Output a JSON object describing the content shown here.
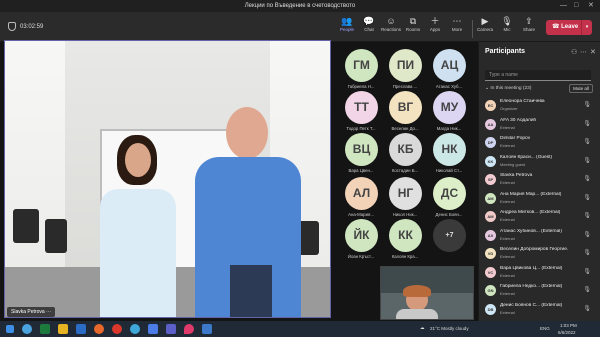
{
  "window": {
    "title": "Лекции по Въведение в счетоводството",
    "controls": [
      "—",
      "□",
      "✕"
    ]
  },
  "toolbar": {
    "timer": "03:02:59",
    "items": [
      {
        "label": "People",
        "icon": "people-icon",
        "glyph": "👥"
      },
      {
        "label": "Chat",
        "icon": "chat-icon",
        "glyph": "💬"
      },
      {
        "label": "Reactions",
        "icon": "reactions-icon",
        "glyph": "☺"
      },
      {
        "label": "Rooms",
        "icon": "rooms-icon",
        "glyph": "⧉"
      },
      {
        "label": "Apps",
        "icon": "apps-icon",
        "glyph": "＋"
      },
      {
        "label": "More",
        "icon": "more-icon",
        "glyph": "⋯"
      },
      {
        "label": "Camera",
        "icon": "camera-icon",
        "glyph": "▶"
      },
      {
        "label": "Mic",
        "icon": "mic-icon",
        "glyph": "🎙"
      },
      {
        "label": "Share",
        "icon": "share-icon",
        "glyph": "⇪"
      }
    ],
    "leave_label": "Leave"
  },
  "main_video": {
    "name": "Slavka Petrova"
  },
  "tiles": [
    {
      "initials": "ГМ",
      "name": "Габриела Н...",
      "bg": "#cfe6c0"
    },
    {
      "initials": "ПИ",
      "name": "Преслава ...",
      "bg": "#dfe8c8"
    },
    {
      "initials": "АЦ",
      "name": "Атанас Хуб...",
      "bg": "#cfe0f0"
    },
    {
      "initials": "ТТ",
      "name": "Тодор Петк Т...",
      "bg": "#f2d6e8"
    },
    {
      "initials": "ВГ",
      "name": "Веселин До...",
      "bg": "#f3e3c0"
    },
    {
      "initials": "МУ",
      "name": "Магда Ник...",
      "bg": "#dcd6f2"
    },
    {
      "initials": "ВЦ",
      "name": "Вара Цвен...",
      "bg": "#cfe6c0"
    },
    {
      "initials": "КБ",
      "name": "Костадин Б...",
      "bg": "#d9d9d9"
    },
    {
      "initials": "НК",
      "name": "Николай Ст...",
      "bg": "#cce8e6"
    },
    {
      "initials": "АЛ",
      "name": "Ана-Мария...",
      "bg": "#f3d3b8"
    },
    {
      "initials": "НГ",
      "name": "Никол Ник...",
      "bg": "#e0e0e0"
    },
    {
      "initials": "ДС",
      "name": "Денис Боян...",
      "bg": "#dcefc8"
    },
    {
      "initials": "ЙК",
      "name": "Йоан Кръст...",
      "bg": "#cfe6c0"
    },
    {
      "initials": "КК",
      "name": "Калоян Кра...",
      "bg": "#cfe6c0"
    },
    {
      "initials": "+7",
      "name": "",
      "bg": "#3a3a3a"
    }
  ],
  "participants_panel": {
    "title": "Participants",
    "search_placeholder": "Type a name",
    "in_meeting": "In this meeting (23)",
    "mute_all": "Mute all",
    "people": [
      {
        "initials": "EC",
        "name": "Елеонора Стаичева",
        "role": "Organizer",
        "bg": "#f3d3b8"
      },
      {
        "initials": "AA",
        "name": "AFA 30 Аодалиh",
        "role": "External",
        "bg": "#e5c7df"
      },
      {
        "initials": "DP",
        "name": "Dimitar Popov",
        "role": "External",
        "bg": "#cfd4f0"
      },
      {
        "initials": "KK",
        "name": "Калоян Краси... (Guest)",
        "role": "Meeting guest",
        "bg": "#cfe6f5"
      },
      {
        "initials": "SP",
        "name": "Slavka Petrova",
        "role": "External",
        "bg": "#f2cbd1"
      },
      {
        "initials": "AM",
        "name": "Ана Мария Мар... (External)",
        "role": "External",
        "bg": "#cfe6c0"
      },
      {
        "initials": "AM",
        "name": "Андреа Митков... (External)",
        "role": "External",
        "bg": "#f0c9c9"
      },
      {
        "initials": "AX",
        "name": "Атанас Хубинов... (External)",
        "role": "External",
        "bg": "#e5c7df"
      },
      {
        "initials": "VD",
        "name": "Веселин Добромиров Георгие...",
        "role": "External",
        "bg": "#f3e3c0"
      },
      {
        "initials": "VC",
        "name": "Вара Цвикова Ц... (External)",
        "role": "External",
        "bg": "#f2cbd1"
      },
      {
        "initials": "GN",
        "name": "Габриела Недко... (External)",
        "role": "External",
        "bg": "#cfe6c0"
      },
      {
        "initials": "DB",
        "name": "Денис Боянов С... (External)",
        "role": "External",
        "bg": "#cfe6f5"
      }
    ]
  },
  "taskbar": {
    "weather": "21°C  Mostly cloudy",
    "language": "ENG",
    "time": "1:03 PM",
    "date": "6/6/2022"
  }
}
